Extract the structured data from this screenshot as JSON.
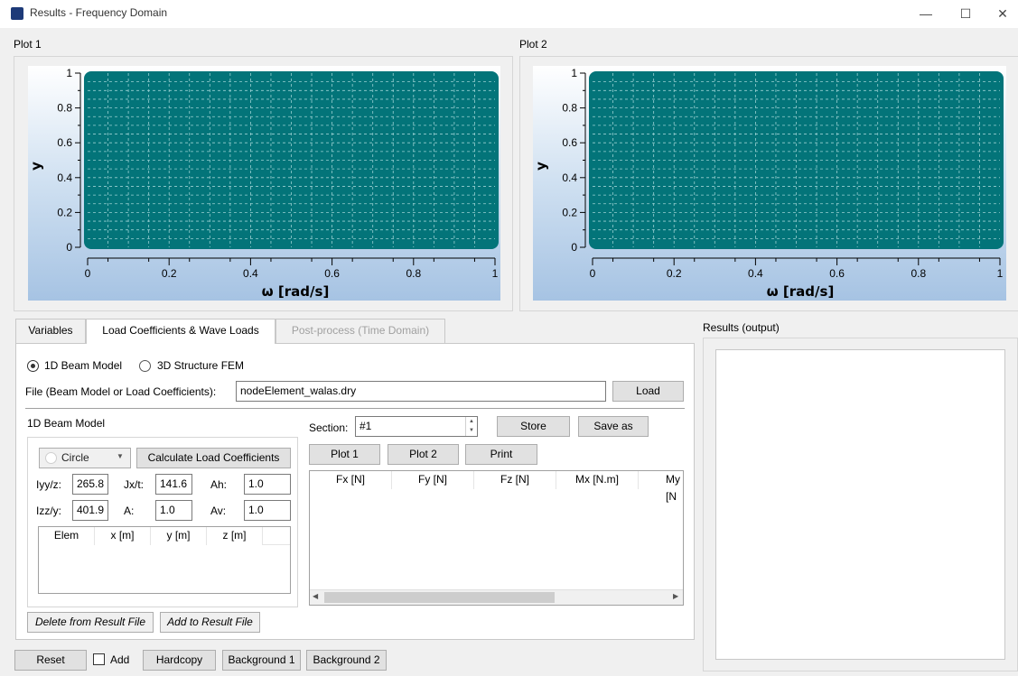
{
  "window": {
    "title": "Results - Frequency Domain",
    "icon_text": "[logo]",
    "controls": {
      "minimize": "—",
      "maximize": "☐",
      "close": "✕"
    }
  },
  "plot1": {
    "label": "Plot 1",
    "ylabel": "y",
    "xlabel": "ω [rad/s]",
    "xticks": [
      "0",
      "0.2",
      "0.4",
      "0.6",
      "0.8",
      "1"
    ],
    "yticks": [
      "0",
      "0.2",
      "0.4",
      "0.6",
      "0.8",
      "1"
    ]
  },
  "plot2": {
    "label": "Plot 2",
    "ylabel": "y",
    "xlabel": "ω [rad/s]",
    "xticks": [
      "0",
      "0.2",
      "0.4",
      "0.6",
      "0.8",
      "1"
    ],
    "yticks": [
      "0",
      "0.2",
      "0.4",
      "0.6",
      "0.8",
      "1"
    ]
  },
  "colors": {
    "plot_fill": "#037479",
    "grid": "#9ad0d2"
  },
  "tabs": [
    {
      "label": "Variables"
    },
    {
      "label": "Load Coefficients & Wave Loads"
    },
    {
      "label": "Post-process (Time Domain)"
    }
  ],
  "model": {
    "option1": "1D Beam Model",
    "option2": "3D Structure FEM",
    "file_label": "File (Beam Model or Load Coefficients):",
    "file_value": "nodeElement_walas.dry",
    "load_button": "Load"
  },
  "beam": {
    "group_label": "1D Beam Model",
    "shape": "Circle",
    "calc_button": "Calculate Load Coefficients",
    "iyy_label": "Iyy/z:",
    "iyy_value": "265.8",
    "jx_label": "Jx/t:",
    "jx_value": "141.6",
    "ah_label": "Ah:",
    "ah_value": "1.0",
    "izz_label": "Izz/y:",
    "izz_value": "401.9",
    "a_label": "A:",
    "a_value": "1.0",
    "av_label": "Av:",
    "av_value": "1.0",
    "table_headers": [
      "Elem",
      "x [m]",
      "y [m]",
      "z [m]"
    ]
  },
  "section": {
    "label": "Section:",
    "value": "#1",
    "store_button": "Store",
    "saveas_button": "Save as",
    "plot1_button": "Plot 1",
    "plot2_button": "Plot 2",
    "print_button": "Print",
    "table_headers": [
      "Fx [N]",
      "Fy [N]",
      "Fz [N]",
      "Mx [N.m]",
      "My [N"
    ]
  },
  "result_file": {
    "delete_button": "Delete from Result File",
    "add_button": "Add to Result File"
  },
  "bottom": {
    "reset_button": "Reset",
    "add_label": "Add",
    "hardcopy_button": "Hardcopy",
    "bg1_button": "Background 1",
    "bg2_button": "Background 2"
  },
  "output": {
    "label": "Results (output)"
  }
}
